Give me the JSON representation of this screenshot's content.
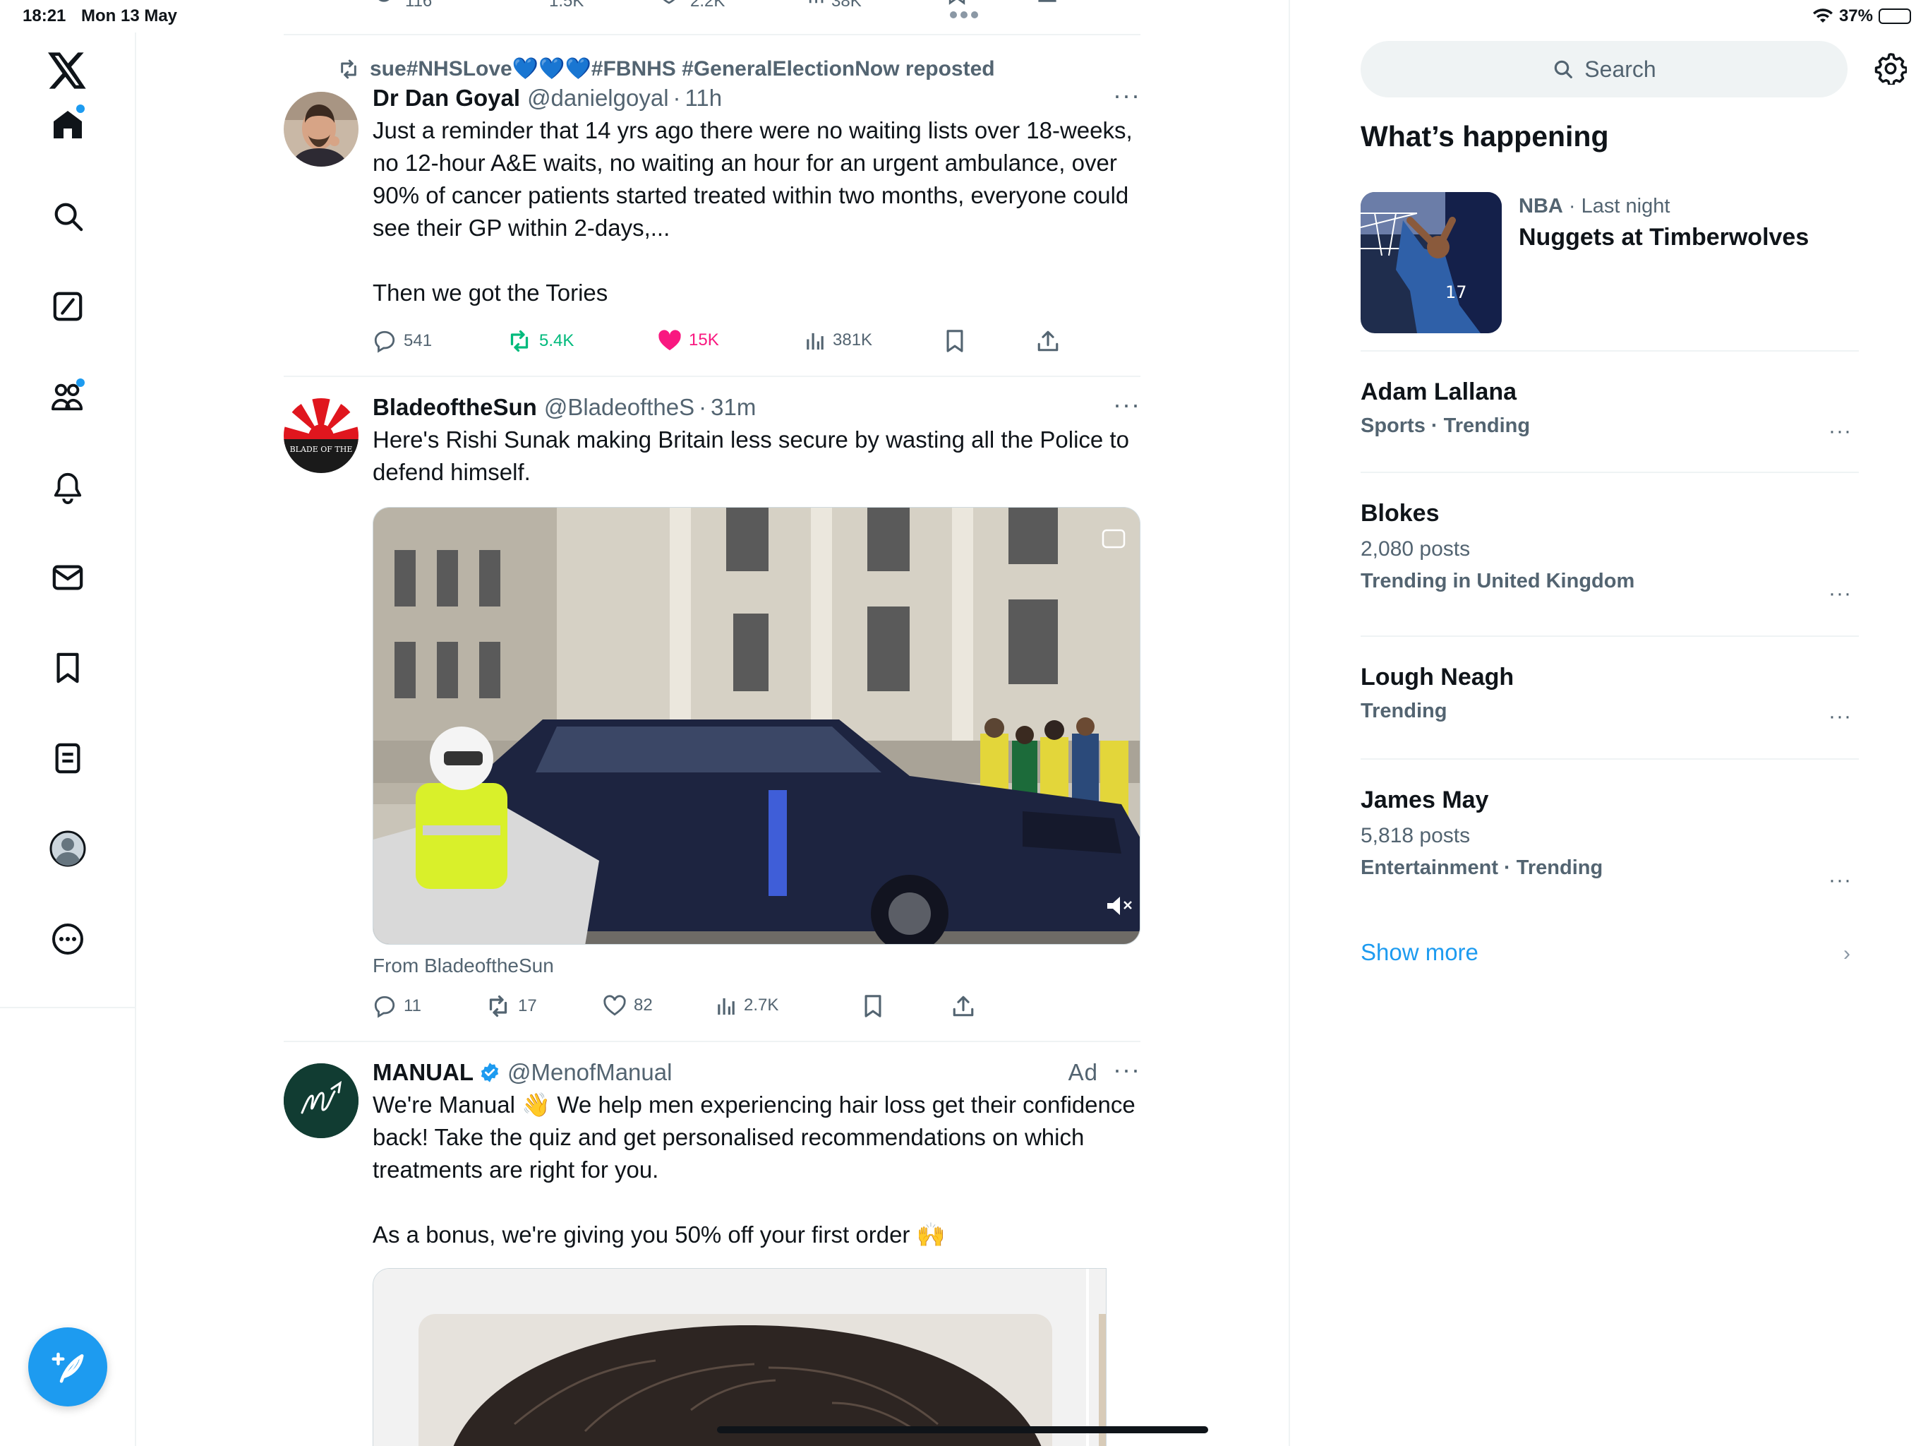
{
  "status_bar": {
    "time": "18:21",
    "date": "Mon 13 May",
    "battery": "37%",
    "battery_level": 0.37
  },
  "nav": {
    "items": [
      "home",
      "explore",
      "grok",
      "communities",
      "notifications",
      "messages",
      "bookmarks",
      "lists",
      "profile",
      "more"
    ],
    "compose_label": "Post"
  },
  "timeline": {
    "previous_tweet_stats": {
      "replies": "116",
      "reposts": "1.5K",
      "likes": "2.2K",
      "views": "38K"
    },
    "tweets": [
      {
        "reposted_by": "sue#NHSLove💙💙💙#FBNHS #GeneralElectionNow reposted",
        "name": "Dr Dan Goyal",
        "handle": "@danielgoyal",
        "time": "11h",
        "text": "Just a reminder that 14 yrs ago there were no waiting lists over 18-weeks, no 12-hour A&E waits, no waiting an hour for an urgent ambulance, over 90% of cancer patients started treated within two months, everyone could see their GP within 2-days,...\n\nThen we got the Tories",
        "replies": "541",
        "reposts": "5.4K",
        "likes": "15K",
        "views": "381K"
      },
      {
        "name": "BladeoftheSun",
        "handle": "@BladeoftheS",
        "time": "31m",
        "text": "Here's Rishi Sunak making Britain less secure by wasting all the Police to defend himself.",
        "from": "From BladeoftheSun",
        "avatar_text": "BLADE OF THE",
        "replies": "11",
        "reposts": "17",
        "likes": "82",
        "views": "2.7K"
      },
      {
        "name": "MANUAL",
        "handle": "@MenofManual",
        "ad_label": "Ad",
        "text": "We're Manual 👋 We help men experiencing hair loss get their confidence back! Take the quiz and get personalised recommendations on which treatments are right for you.\n\nAs a bonus, we're giving you 50% off your first order 🙌"
      }
    ]
  },
  "sidebar": {
    "search_placeholder": "Search",
    "heading": "What’s happening",
    "featured": {
      "category": "NBA",
      "when": "Last night",
      "title": "Nuggets at Timberwolves"
    },
    "trends": [
      {
        "name": "Adam Lallana",
        "meta": "Sports · Trending"
      },
      {
        "name": "Blokes",
        "posts": "2,080 posts",
        "meta": "Trending in United Kingdom"
      },
      {
        "name": "Lough Neagh",
        "meta": "Trending"
      },
      {
        "name": "James May",
        "posts": "5,818 posts",
        "meta": "Entertainment · Trending"
      }
    ],
    "show_more": "Show more"
  },
  "colors": {
    "accent": "#1d9bf0",
    "like": "#f91880",
    "repost": "#00ba7c",
    "muted": "#536471"
  }
}
